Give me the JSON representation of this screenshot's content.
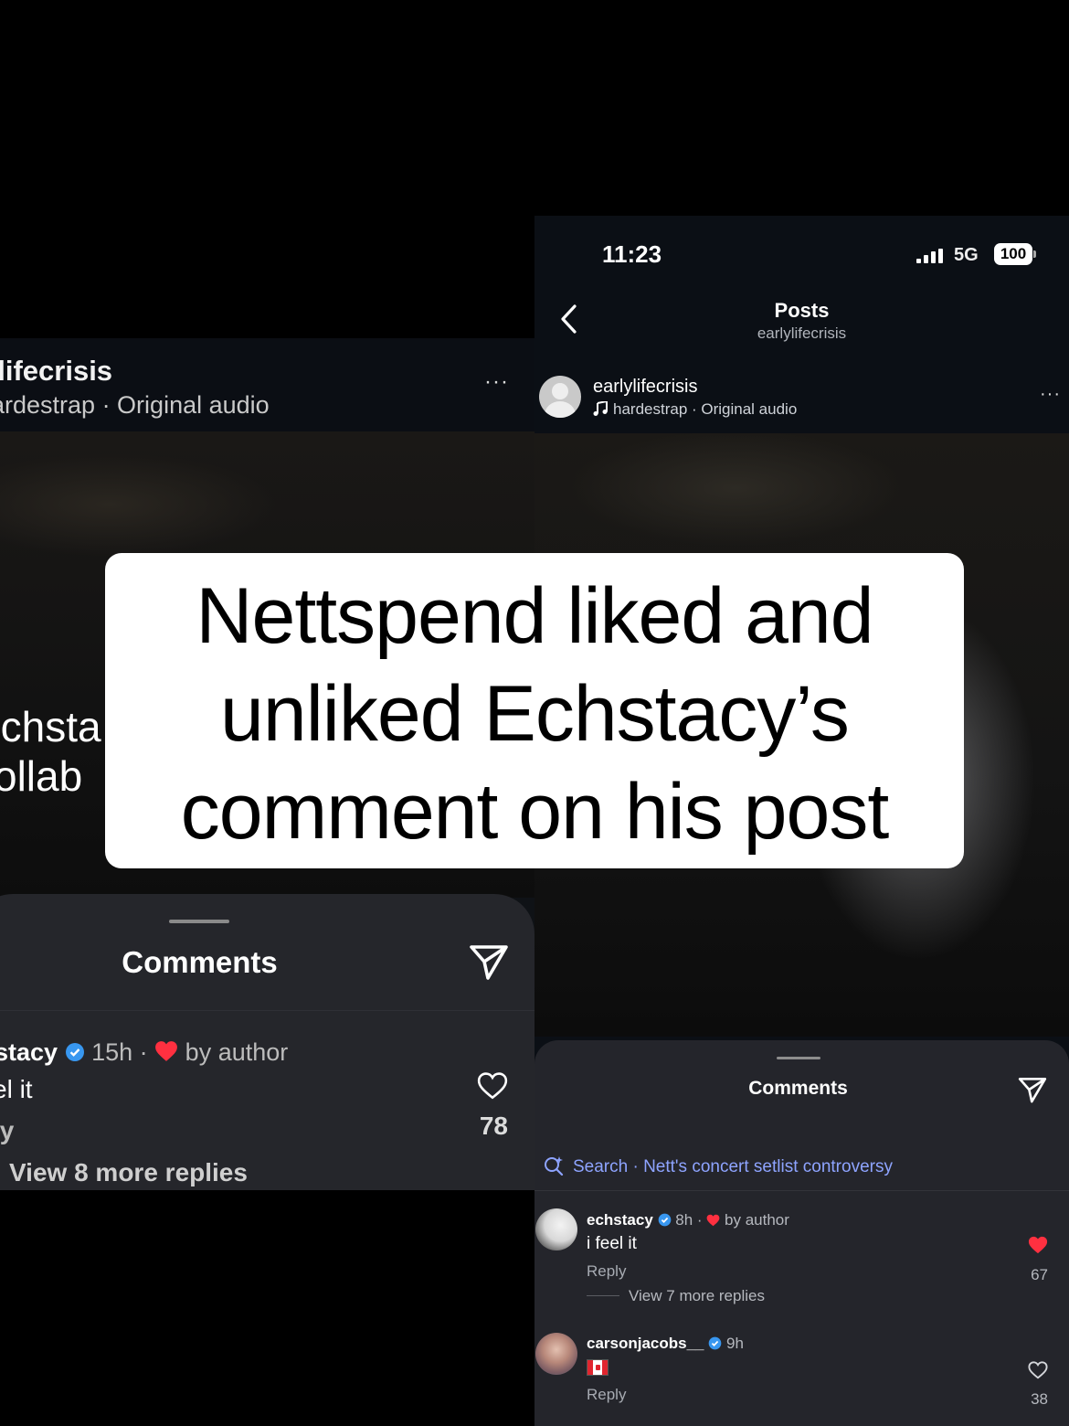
{
  "left_screenshot": {
    "header": {
      "account": "ylifecrisis",
      "audio": "ardestrap · Original audio",
      "more": "···"
    },
    "video_overlay_lines": [
      "Echsta",
      "collab"
    ],
    "comments_sheet": {
      "title": "Comments",
      "comment": {
        "username": "stacy",
        "time": "15h ·",
        "by_author": "by author",
        "text": "el it",
        "reply": "ly",
        "likes": "78",
        "view_replies": "View 8 more replies"
      }
    }
  },
  "right_screenshot": {
    "status_bar": {
      "time": "11:23",
      "network": "5G",
      "battery": "100"
    },
    "nav": {
      "title": "Posts",
      "subtitle": "earlylifecrisis"
    },
    "post_header": {
      "account": "earlylifecrisis",
      "audio": "hardestrap · Original audio",
      "more": "···"
    },
    "comments_sheet": {
      "title": "Comments",
      "search_suggestion": "Search · Nett's concert setlist controversy",
      "comments": [
        {
          "username": "echstacy",
          "time": "8h ·",
          "by_author": "by author",
          "text": "i feel it",
          "reply": "Reply",
          "view_replies": "View 7 more replies",
          "likes": "67",
          "liked": true
        },
        {
          "username": "carsonjacobs__",
          "time": "9h",
          "text": "",
          "reply": "Reply",
          "likes": "38",
          "liked": false
        }
      ]
    }
  },
  "caption_overlay": {
    "lines": [
      "Nettspend liked and",
      "unliked Echstacy’s",
      "comment on his post"
    ]
  },
  "colors": {
    "background": "#000000",
    "sheet": "#25262b",
    "verified_blue": "#3897f0",
    "heart_red": "#ff3040",
    "search_link": "#8ea4ff"
  }
}
